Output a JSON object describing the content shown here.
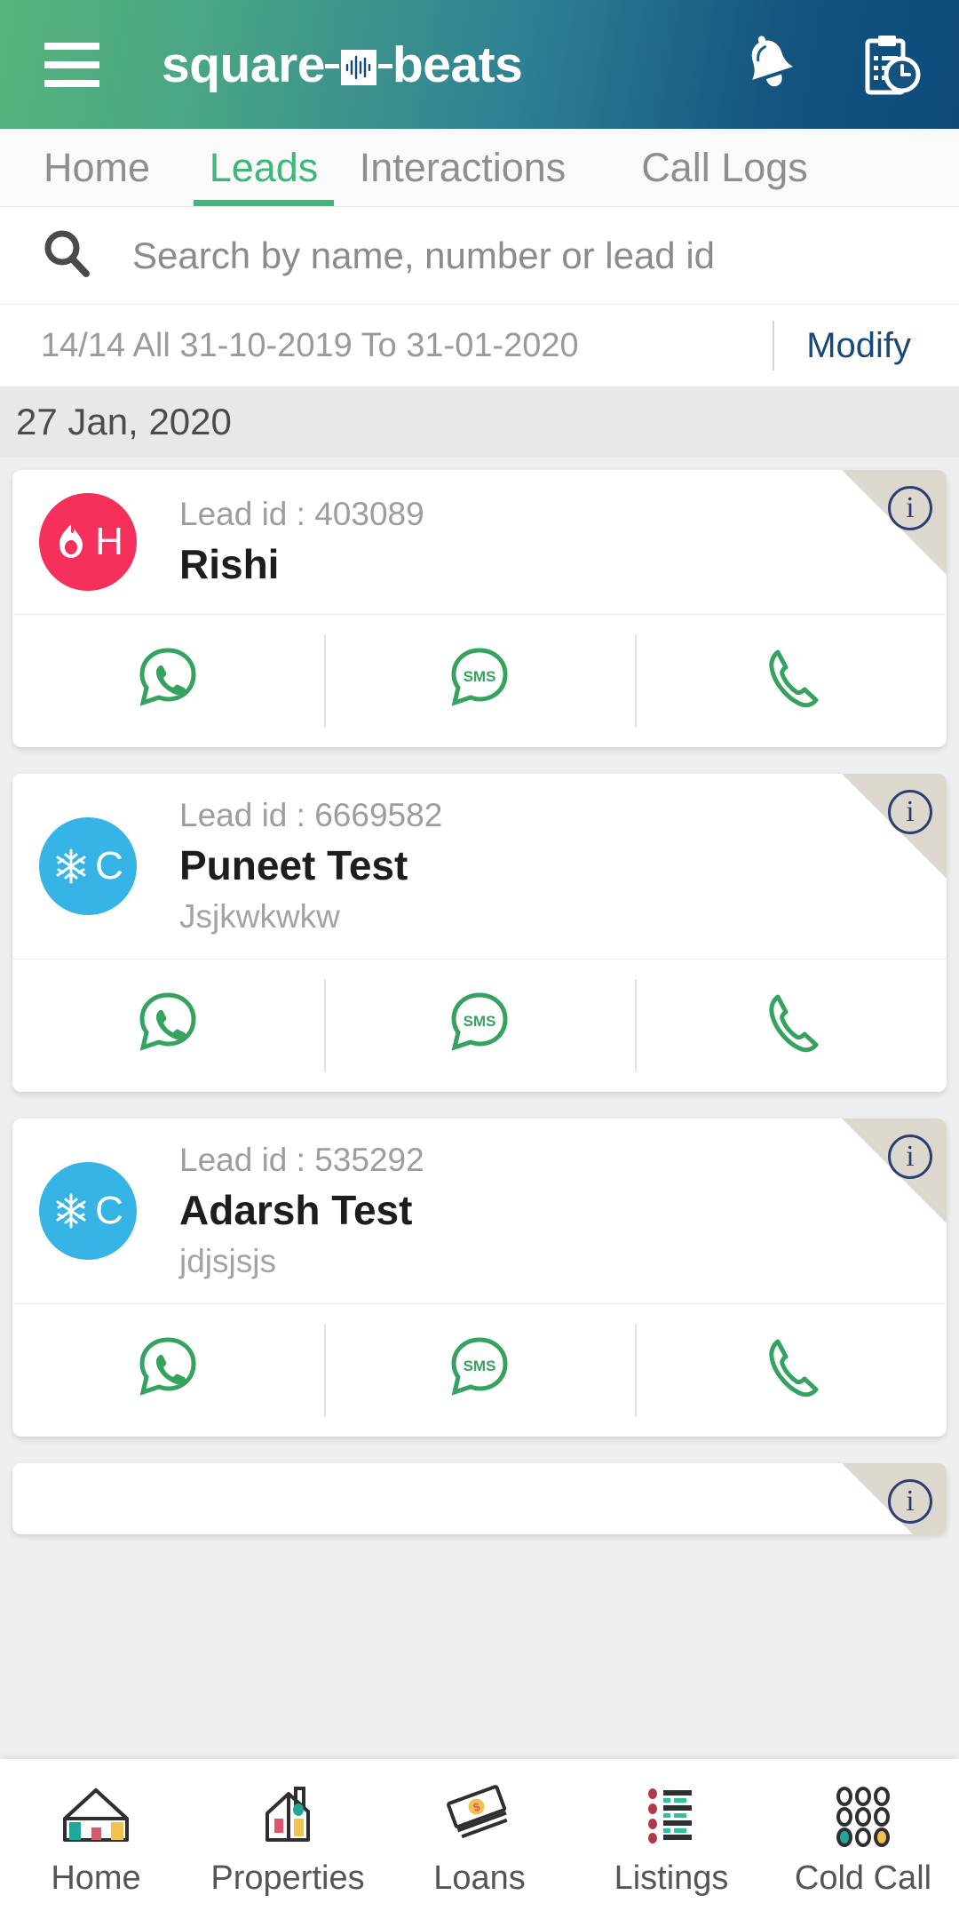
{
  "app": {
    "brand_left": "square",
    "brand_right": "beats",
    "menu_icon": "hamburger-menu-icon",
    "notification_icon": "bell-icon",
    "task_icon": "clipboard-clock-icon"
  },
  "tabs": [
    {
      "label": "Home",
      "active": false
    },
    {
      "label": "Leads",
      "active": true
    },
    {
      "label": "Interactions",
      "active": false
    },
    {
      "label": "Call Logs",
      "active": false
    }
  ],
  "search": {
    "placeholder": "Search by name, number or lead id",
    "icon": "search-icon"
  },
  "filter": {
    "summary": "14/14 All 31-10-2019 To 31-01-2020",
    "modify_label": "Modify"
  },
  "date_group": {
    "label": "27 Jan, 2020"
  },
  "lead_labels": {
    "lead_id_prefix": "Lead id : ",
    "info_badge": "i",
    "whatsapp_label": "whatsapp-icon",
    "sms_label": "SMS",
    "call_label": "call-icon"
  },
  "leads": [
    {
      "lead_id": "Lead id : 403089",
      "name": "Rishi",
      "subtitle": "",
      "status_letter": "H",
      "status_type": "hot",
      "avatar_color": "#f5315b"
    },
    {
      "lead_id": "Lead id : 6669582",
      "name": "Puneet Test",
      "subtitle": "Jsjkwkwkw",
      "status_letter": "C",
      "status_type": "cold",
      "avatar_color": "#36b4e5"
    },
    {
      "lead_id": "Lead id : 535292",
      "name": "Adarsh Test",
      "subtitle": "jdjsjsjs",
      "status_letter": "C",
      "status_type": "cold",
      "avatar_color": "#36b4e5"
    }
  ],
  "bottom_nav": [
    {
      "label": "Home",
      "icon": "house-icon"
    },
    {
      "label": "Properties",
      "icon": "building-icon"
    },
    {
      "label": "Loans",
      "icon": "money-stack-icon"
    },
    {
      "label": "Listings",
      "icon": "list-icon"
    },
    {
      "label": "Cold Call",
      "icon": "dialpad-icon"
    }
  ],
  "colors": {
    "accent_green": "#3cb878",
    "header_gradient_start": "#56b47c",
    "header_gradient_end": "#0d4a7a",
    "modify_blue": "#17497c",
    "corner_beige": "#dcd8cd",
    "action_green": "#35a35f"
  }
}
